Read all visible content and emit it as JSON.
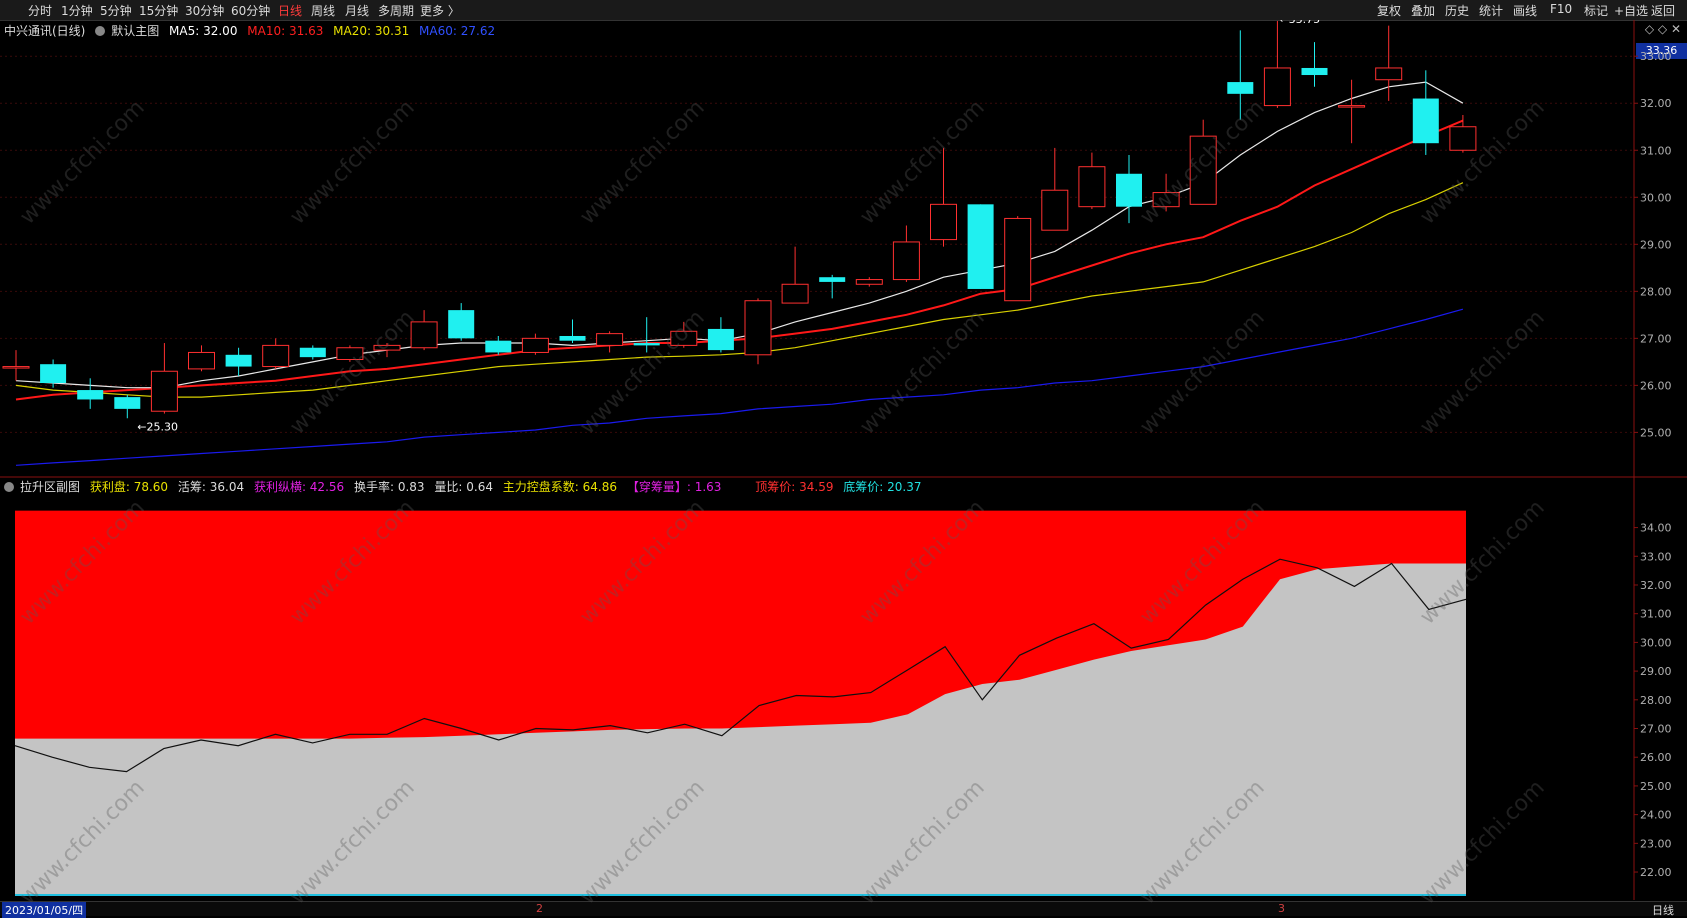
{
  "toolbar": {
    "periods": [
      "分时",
      "1分钟",
      "5分钟",
      "15分钟",
      "30分钟",
      "60分钟",
      "日线",
      "周线",
      "月线",
      "多周期",
      "更多 〉"
    ],
    "active_period": "日线",
    "right_buttons": [
      "复权",
      "叠加",
      "历史",
      "统计",
      "画线",
      "F10",
      "标记",
      "+自选",
      "返回"
    ]
  },
  "main_legend": {
    "stock": "中兴通讯(日线)",
    "template": "默认主图",
    "ma5": "MA5: 32.00",
    "ma10": "MA10: 31.63",
    "ma20": "MA20: 30.31",
    "ma60": "MA60: 27.62",
    "colors": {
      "ma5": "#ffffff",
      "ma10": "#ff2020",
      "ma20": "#e8e000",
      "ma60": "#2020ff"
    }
  },
  "sub_legend": {
    "title": "拉升区副图",
    "profit": "获利盘: 78.60",
    "active": "活筹: 36.04",
    "profit_vertical": "获利纵横: 42.56",
    "turnover": "换手率: 0.83",
    "volume_ratio": "量比: 0.64",
    "main_control": "主力控盘系数: 64.86",
    "chuanchou": "【穿筹量】: 1.63",
    "top_price": "顶筹价: 34.59",
    "bottom_price": "底筹价: 20.37"
  },
  "top_icons": "◇ ◇ ✕",
  "current_price_tag": "33.36",
  "annotations": {
    "high": "33.75",
    "low": "25.30"
  },
  "bottom": {
    "date": "2023/01/05/四",
    "month_marks": [
      "2",
      "3"
    ],
    "period": "日线"
  },
  "watermark": "www.cfchi.com",
  "chart_data": [
    {
      "type": "candlestick",
      "title": "中兴通讯(日线)",
      "ylim": [
        24.2,
        33.6
      ],
      "y_ticks": [
        "33.00",
        "32.00",
        "31.00",
        "30.00",
        "29.00",
        "28.00",
        "27.00",
        "26.00",
        "25.00"
      ],
      "candles": [
        {
          "o": 26.4,
          "c": 26.4,
          "h": 26.75,
          "l": 26.1
        },
        {
          "o": 26.45,
          "c": 26.05,
          "h": 26.55,
          "l": 25.95
        },
        {
          "o": 25.9,
          "c": 25.7,
          "h": 26.15,
          "l": 25.5
        },
        {
          "o": 25.75,
          "c": 25.5,
          "h": 25.8,
          "l": 25.3
        },
        {
          "o": 25.45,
          "c": 26.3,
          "h": 26.9,
          "l": 25.4
        },
        {
          "o": 26.35,
          "c": 26.7,
          "h": 26.85,
          "l": 26.3
        },
        {
          "o": 26.65,
          "c": 26.4,
          "h": 26.8,
          "l": 26.2
        },
        {
          "o": 26.4,
          "c": 26.85,
          "h": 27.0,
          "l": 26.35
        },
        {
          "o": 26.8,
          "c": 26.6,
          "h": 26.85,
          "l": 26.55
        },
        {
          "o": 26.55,
          "c": 26.8,
          "h": 26.85,
          "l": 26.5
        },
        {
          "o": 26.75,
          "c": 26.85,
          "h": 26.9,
          "l": 26.6
        },
        {
          "o": 26.8,
          "c": 27.35,
          "h": 27.6,
          "l": 26.75
        },
        {
          "o": 27.6,
          "c": 27.0,
          "h": 27.75,
          "l": 26.95
        },
        {
          "o": 26.95,
          "c": 26.7,
          "h": 27.05,
          "l": 26.65
        },
        {
          "o": 26.7,
          "c": 27.0,
          "h": 27.1,
          "l": 26.65
        },
        {
          "o": 27.05,
          "c": 26.95,
          "h": 27.4,
          "l": 26.9
        },
        {
          "o": 26.85,
          "c": 27.1,
          "h": 27.15,
          "l": 26.7
        },
        {
          "o": 26.9,
          "c": 26.85,
          "h": 27.45,
          "l": 26.7
        },
        {
          "o": 26.85,
          "c": 27.15,
          "h": 27.35,
          "l": 26.8
        },
        {
          "o": 27.2,
          "c": 26.75,
          "h": 27.45,
          "l": 26.7
        },
        {
          "o": 26.65,
          "c": 27.8,
          "h": 27.85,
          "l": 26.45
        },
        {
          "o": 27.75,
          "c": 28.15,
          "h": 28.95,
          "l": 27.75
        },
        {
          "o": 28.3,
          "c": 28.2,
          "h": 28.35,
          "l": 27.85
        },
        {
          "o": 28.15,
          "c": 28.25,
          "h": 28.3,
          "l": 28.1
        },
        {
          "o": 28.25,
          "c": 29.05,
          "h": 29.4,
          "l": 28.2
        },
        {
          "o": 29.1,
          "c": 29.85,
          "h": 31.05,
          "l": 28.95
        },
        {
          "o": 29.85,
          "c": 28.05,
          "h": 29.85,
          "l": 28.05
        },
        {
          "o": 27.8,
          "c": 29.55,
          "h": 29.6,
          "l": 27.8
        },
        {
          "o": 29.3,
          "c": 30.15,
          "h": 31.05,
          "l": 29.3
        },
        {
          "o": 29.8,
          "c": 30.65,
          "h": 30.95,
          "l": 29.75
        },
        {
          "o": 30.5,
          "c": 29.8,
          "h": 30.9,
          "l": 29.45
        },
        {
          "o": 29.8,
          "c": 30.1,
          "h": 30.5,
          "l": 29.7
        },
        {
          "o": 29.85,
          "c": 31.3,
          "h": 31.65,
          "l": 29.85
        },
        {
          "o": 32.45,
          "c": 32.2,
          "h": 33.55,
          "l": 31.65
        },
        {
          "o": 31.95,
          "c": 32.75,
          "h": 33.75,
          "l": 31.9
        },
        {
          "o": 32.75,
          "c": 32.6,
          "h": 33.3,
          "l": 32.35
        },
        {
          "o": 31.95,
          "c": 31.95,
          "h": 32.5,
          "l": 31.15
        },
        {
          "o": 32.5,
          "c": 32.75,
          "h": 33.65,
          "l": 32.05
        },
        {
          "o": 32.1,
          "c": 31.15,
          "h": 32.7,
          "l": 30.9
        },
        {
          "o": 31.0,
          "c": 31.5,
          "h": 31.75,
          "l": 30.95
        }
      ],
      "ma5": [
        26.1,
        26.05,
        26.0,
        25.95,
        25.95,
        26.1,
        26.2,
        26.35,
        26.5,
        26.65,
        26.75,
        26.85,
        26.9,
        26.9,
        26.9,
        26.85,
        26.9,
        26.95,
        27.0,
        26.95,
        27.1,
        27.35,
        27.55,
        27.75,
        28.0,
        28.3,
        28.45,
        28.6,
        28.85,
        29.3,
        29.8,
        30.0,
        30.3,
        30.9,
        31.4,
        31.8,
        32.1,
        32.35,
        32.45,
        32.0
      ],
      "ma10": [
        25.7,
        25.8,
        25.85,
        25.9,
        25.95,
        26.0,
        26.05,
        26.1,
        26.2,
        26.3,
        26.35,
        26.45,
        26.55,
        26.65,
        26.75,
        26.8,
        26.85,
        26.9,
        26.9,
        26.95,
        27.0,
        27.1,
        27.2,
        27.35,
        27.5,
        27.7,
        27.95,
        28.05,
        28.3,
        28.55,
        28.8,
        29.0,
        29.15,
        29.5,
        29.8,
        30.25,
        30.6,
        30.95,
        31.3,
        31.63
      ],
      "ma20": [
        26.0,
        25.9,
        25.85,
        25.8,
        25.75,
        25.75,
        25.8,
        25.85,
        25.9,
        26.0,
        26.1,
        26.2,
        26.3,
        26.4,
        26.45,
        26.5,
        26.55,
        26.6,
        26.62,
        26.65,
        26.7,
        26.8,
        26.95,
        27.1,
        27.25,
        27.4,
        27.5,
        27.6,
        27.75,
        27.9,
        28.0,
        28.1,
        28.2,
        28.45,
        28.7,
        28.95,
        29.25,
        29.65,
        29.95,
        30.31
      ],
      "ma60": [
        24.3,
        24.35,
        24.4,
        24.45,
        24.5,
        24.55,
        24.6,
        24.65,
        24.7,
        24.75,
        24.8,
        24.9,
        24.95,
        25.0,
        25.05,
        25.15,
        25.2,
        25.3,
        25.35,
        25.4,
        25.5,
        25.55,
        25.6,
        25.7,
        25.75,
        25.8,
        25.9,
        25.95,
        26.05,
        26.1,
        26.2,
        26.3,
        26.4,
        26.55,
        26.7,
        26.85,
        27.0,
        27.2,
        27.4,
        27.62
      ]
    },
    {
      "type": "area",
      "title": "拉升区副图",
      "ylim": [
        21.2,
        35.1
      ],
      "y_ticks": [
        "34.00",
        "33.00",
        "32.00",
        "31.00",
        "30.00",
        "29.00",
        "28.00",
        "27.00",
        "26.00",
        "25.00",
        "24.00",
        "23.00",
        "22.00"
      ],
      "top": 34.59,
      "red_floor": [
        26.65,
        26.65,
        26.65,
        26.65,
        26.65,
        26.65,
        26.65,
        26.65,
        26.65,
        26.65,
        26.68,
        26.7,
        26.75,
        26.8,
        26.85,
        26.9,
        26.95,
        26.98,
        27.0,
        27.0,
        27.05,
        27.1,
        27.15,
        27.2,
        27.5,
        28.2,
        28.55,
        28.7,
        29.05,
        29.4,
        29.7,
        29.9,
        30.1,
        30.55,
        32.2,
        32.55,
        32.65,
        32.75,
        32.75,
        32.75
      ],
      "price_line": [
        26.4,
        26.0,
        25.65,
        25.5,
        26.3,
        26.6,
        26.4,
        26.8,
        26.5,
        26.8,
        26.8,
        27.35,
        27.0,
        26.6,
        27.0,
        26.95,
        27.1,
        26.85,
        27.15,
        26.75,
        27.8,
        28.15,
        28.1,
        28.25,
        29.05,
        29.85,
        28.0,
        29.55,
        30.15,
        30.65,
        29.8,
        30.1,
        31.3,
        32.2,
        32.9,
        32.6,
        31.95,
        32.75,
        31.15,
        31.5
      ]
    }
  ]
}
